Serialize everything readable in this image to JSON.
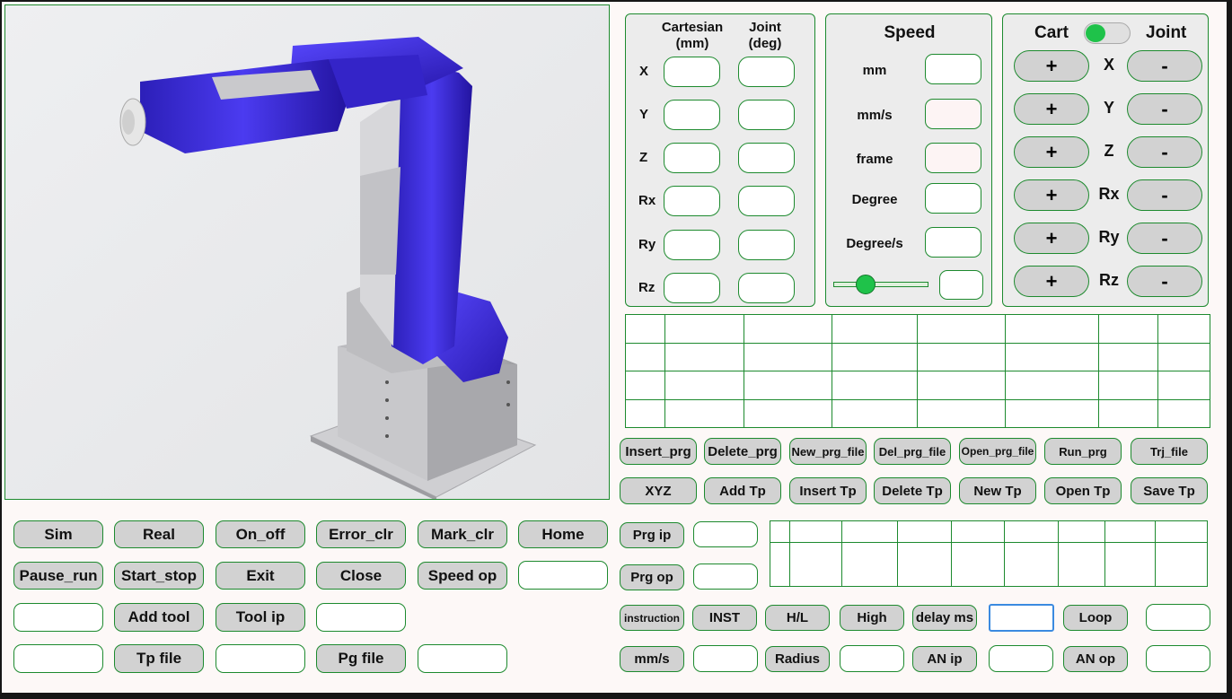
{
  "viewport": {
    "alt": "robot-arm-render"
  },
  "coords": {
    "cartesian_header": "Cartesian\n(mm)",
    "joint_header": "Joint\n(deg)",
    "axes": [
      "X",
      "Y",
      "Z",
      "Rx",
      "Ry",
      "Rz"
    ]
  },
  "speed": {
    "title": "Speed",
    "rows": [
      "mm",
      "mm/s",
      "frame",
      "Degree",
      "Degree/s"
    ],
    "slider_value": 0.3
  },
  "jog": {
    "left_label": "Cart",
    "right_label": "Joint",
    "toggle_color": "#1fc24a",
    "plus": "+",
    "minus": "-",
    "axes": [
      "X",
      "Y",
      "Z",
      "Rx",
      "Ry",
      "Rz"
    ]
  },
  "program_buttons": {
    "row1": [
      "Insert_prg",
      "Delete_prg",
      "New_prg_file",
      "Del_prg_file",
      "Open_prg_file",
      "Run_prg",
      "Trj_file"
    ],
    "row2": [
      "XYZ",
      "Add Tp",
      "Insert Tp",
      "Delete Tp",
      "New Tp",
      "Open Tp",
      "Save Tp"
    ]
  },
  "control": {
    "row1": [
      "Sim",
      "Real",
      "On_off",
      "Error_clr",
      "Mark_clr",
      "Home"
    ],
    "row2": [
      "Pause_run",
      "Start_stop",
      "Exit",
      "Close",
      "Speed op"
    ],
    "add_tool": "Add tool",
    "tool_ip": "Tool ip",
    "tp_file": "Tp file",
    "pg_file": "Pg file"
  },
  "io": {
    "prg_ip": "Prg ip",
    "prg_op": "Prg op"
  },
  "instr": {
    "row1": [
      "instruction",
      "INST",
      "H/L",
      "High",
      "delay ms"
    ],
    "loop": "Loop",
    "mm_s": "mm/s",
    "radius": "Radius",
    "an_ip": "AN ip",
    "an_op": "AN op"
  },
  "colors": {
    "accent_green": "#1d8a2e",
    "robot_blue": "#3f2fd8",
    "focus_blue": "#3b8ae0"
  }
}
